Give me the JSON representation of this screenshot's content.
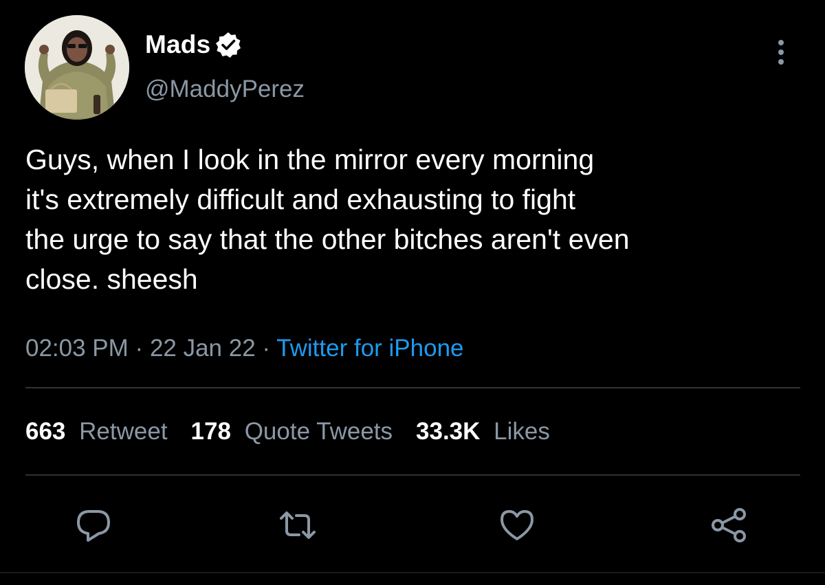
{
  "user": {
    "display_name": "Mads",
    "handle": "@MaddyPerez",
    "verified": true
  },
  "tweet": {
    "text": "Guys, when I look in the mirror every morning\nit's extremely difficult and exhausting to fight\nthe urge to say that the other bitches aren't even\nclose. sheesh",
    "time": "02:03 PM",
    "date": "22 Jan 22",
    "separator": "·",
    "source": "Twitter for iPhone"
  },
  "stats": {
    "retweets_count": "663",
    "retweets_label": "Retweet",
    "quotes_count": "178",
    "quotes_label": "Quote Tweets",
    "likes_count": "33.3K",
    "likes_label": "Likes"
  },
  "icons": {
    "verified": "verified-badge-icon",
    "more": "more-vertical-icon",
    "reply": "reply-icon",
    "retweet": "retweet-icon",
    "like": "heart-icon",
    "share": "share-icon"
  },
  "colors": {
    "background": "#000000",
    "text_primary": "#ffffff",
    "text_secondary": "#8b98a5",
    "link": "#1d9bf0",
    "divider": "#2f3336"
  }
}
